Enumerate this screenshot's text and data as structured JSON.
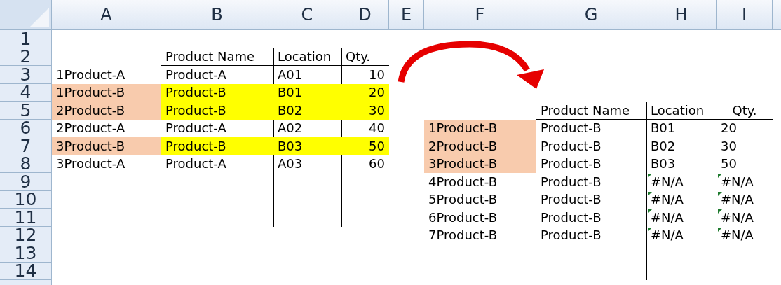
{
  "columns": [
    "A",
    "B",
    "C",
    "D",
    "E",
    "F",
    "G",
    "H",
    "I"
  ],
  "rows": [
    {
      "header": "1",
      "cells": {}
    },
    {
      "header": "2",
      "cells": {
        "B": {
          "text": "Product Name"
        },
        "C": {
          "text": "Location"
        },
        "D": {
          "text": "Qty."
        }
      }
    },
    {
      "header": "3",
      "cells": {
        "A": {
          "text": "1Product-A"
        },
        "B": {
          "text": "Product-A"
        },
        "C": {
          "text": "A01"
        },
        "D": {
          "text": "10",
          "numeric": true
        }
      }
    },
    {
      "header": "4",
      "cells": {
        "A": {
          "text": "1Product-B",
          "color": "#f8cbad"
        },
        "B": {
          "text": "Product-B",
          "color": "#ffff00"
        },
        "C": {
          "text": "B01",
          "color": "#ffff00"
        },
        "D": {
          "text": "20",
          "numeric": true,
          "color": "#ffff00"
        }
      }
    },
    {
      "header": "5",
      "cells": {
        "A": {
          "text": "2Product-B",
          "color": "#f8cbad"
        },
        "B": {
          "text": "Product-B",
          "color": "#ffff00"
        },
        "C": {
          "text": "B02",
          "color": "#ffff00"
        },
        "D": {
          "text": "30",
          "numeric": true,
          "color": "#ffff00"
        },
        "G": {
          "text": "Product Name"
        },
        "H": {
          "text": "Location"
        },
        "I": {
          "text": "Qty.",
          "centered": true
        }
      }
    },
    {
      "header": "6",
      "cells": {
        "A": {
          "text": "2Product-A"
        },
        "B": {
          "text": "Product-A"
        },
        "C": {
          "text": "A02"
        },
        "D": {
          "text": "40",
          "numeric": true
        },
        "F": {
          "text": "1Product-B",
          "color": "#f8cbad"
        },
        "G": {
          "text": "Product-B"
        },
        "H": {
          "text": "B01"
        },
        "I": {
          "text": "20"
        }
      }
    },
    {
      "header": "7",
      "cells": {
        "A": {
          "text": "3Product-B",
          "color": "#f8cbad"
        },
        "B": {
          "text": "Product-B",
          "color": "#ffff00"
        },
        "C": {
          "text": "B03",
          "color": "#ffff00"
        },
        "D": {
          "text": "50",
          "numeric": true,
          "color": "#ffff00"
        },
        "F": {
          "text": "2Product-B",
          "color": "#f8cbad"
        },
        "G": {
          "text": "Product-B"
        },
        "H": {
          "text": "B02"
        },
        "I": {
          "text": "30"
        }
      }
    },
    {
      "header": "8",
      "cells": {
        "A": {
          "text": "3Product-A"
        },
        "B": {
          "text": "Product-A"
        },
        "C": {
          "text": "A03"
        },
        "D": {
          "text": "60",
          "numeric": true
        },
        "F": {
          "text": "3Product-B",
          "color": "#f8cbad"
        },
        "G": {
          "text": "Product-B"
        },
        "H": {
          "text": "B03"
        },
        "I": {
          "text": "50"
        }
      }
    },
    {
      "header": "9",
      "cells": {
        "F": {
          "text": "4Product-B"
        },
        "G": {
          "text": "Product-B"
        },
        "H": {
          "text": "#N/A",
          "error_flag": true
        },
        "I": {
          "text": "#N/A",
          "error_flag": true
        }
      }
    },
    {
      "header": "10",
      "cells": {
        "F": {
          "text": "5Product-B"
        },
        "G": {
          "text": "Product-B"
        },
        "H": {
          "text": "#N/A",
          "error_flag": true
        },
        "I": {
          "text": "#N/A",
          "error_flag": true
        }
      }
    },
    {
      "header": "11",
      "cells": {
        "F": {
          "text": "6Product-B"
        },
        "G": {
          "text": "Product-B"
        },
        "H": {
          "text": "#N/A",
          "error_flag": true
        },
        "I": {
          "text": "#N/A",
          "error_flag": true
        }
      }
    },
    {
      "header": "12",
      "cells": {
        "F": {
          "text": "7Product-B"
        },
        "G": {
          "text": "Product-B"
        },
        "H": {
          "text": "#N/A",
          "error_flag": true
        },
        "I": {
          "text": "#N/A",
          "error_flag": true
        }
      }
    },
    {
      "header": "13",
      "cells": {}
    },
    {
      "header": "14",
      "cells": {}
    }
  ]
}
